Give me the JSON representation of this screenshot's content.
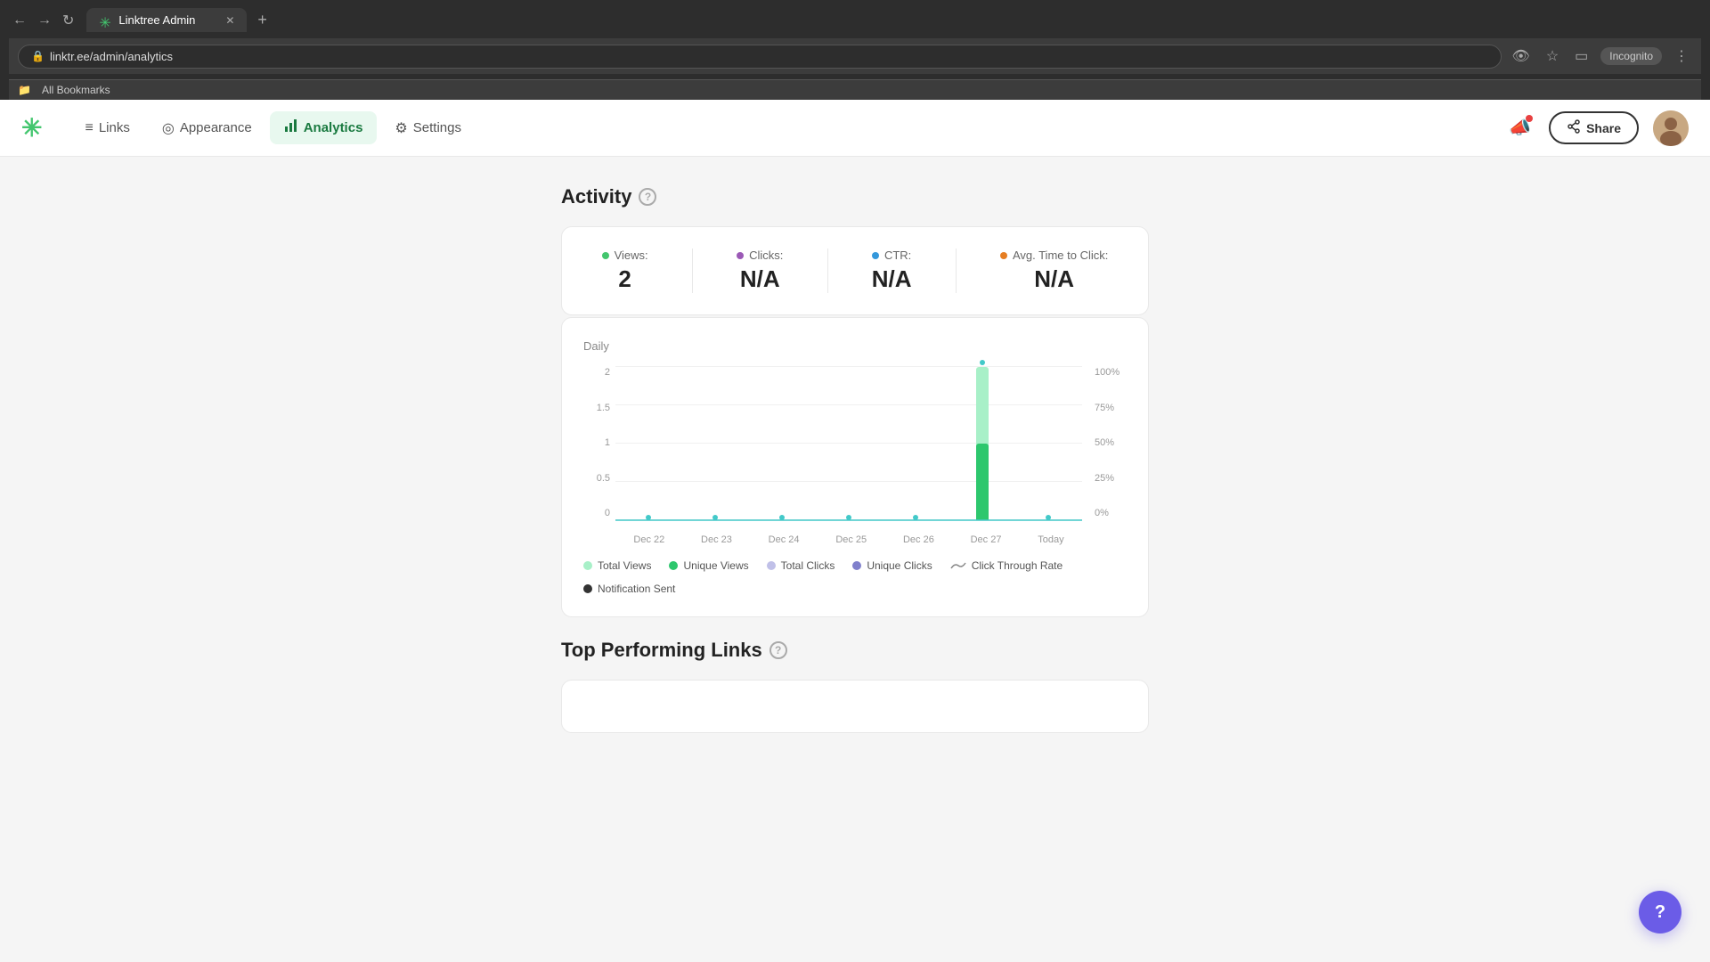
{
  "browser": {
    "tab_title": "Linktree Admin",
    "tab_favicon": "✳",
    "url": "linktr.ee/admin/analytics",
    "incognito_label": "Incognito",
    "bookmarks_label": "All Bookmarks"
  },
  "nav": {
    "logo": "✳",
    "links": [
      {
        "id": "links",
        "label": "Links",
        "icon": "≡",
        "active": false
      },
      {
        "id": "appearance",
        "label": "Appearance",
        "icon": "◎",
        "active": false
      },
      {
        "id": "analytics",
        "label": "Analytics",
        "icon": "📊",
        "active": true
      },
      {
        "id": "settings",
        "label": "Settings",
        "icon": "⚙",
        "active": false
      }
    ],
    "share_label": "Share",
    "notification_icon": "📣"
  },
  "activity": {
    "title": "Activity",
    "stats": [
      {
        "label": "Views:",
        "value": "2",
        "dot_color": "#43c66e"
      },
      {
        "label": "Clicks:",
        "value": "N/A",
        "dot_color": "#9b59b6"
      },
      {
        "label": "CTR:",
        "value": "N/A",
        "dot_color": "#3498db"
      },
      {
        "label": "Avg. Time to Click:",
        "value": "N/A",
        "dot_color": "#e67e22"
      }
    ]
  },
  "chart": {
    "period_label": "Daily",
    "y_axis_left": [
      "2",
      "1.5",
      "1",
      "0.5",
      "0"
    ],
    "y_axis_right": [
      "100%",
      "75%",
      "50%",
      "25%",
      "0%"
    ],
    "x_labels": [
      "Dec 22",
      "Dec 23",
      "Dec 24",
      "Dec 25",
      "Dec 26",
      "Dec 27",
      "Today"
    ],
    "bars": [
      {
        "date": "Dec 22",
        "total_views": 0,
        "unique_views": 0
      },
      {
        "date": "Dec 23",
        "total_views": 0,
        "unique_views": 0
      },
      {
        "date": "Dec 24",
        "total_views": 0,
        "unique_views": 0
      },
      {
        "date": "Dec 25",
        "total_views": 0,
        "unique_views": 0
      },
      {
        "date": "Dec 26",
        "total_views": 0,
        "unique_views": 0
      },
      {
        "date": "Dec 27",
        "total_views": 2,
        "unique_views": 1
      },
      {
        "date": "Today",
        "total_views": 0,
        "unique_views": 0
      }
    ],
    "legend": [
      {
        "label": "Total Views",
        "color": "#a8f0c8",
        "type": "dot"
      },
      {
        "label": "Unique Views",
        "color": "#2dc76d",
        "type": "dot"
      },
      {
        "label": "Total Clicks",
        "color": "#c0c0e8",
        "type": "dot"
      },
      {
        "label": "Unique Clicks",
        "color": "#8080cc",
        "type": "dot"
      },
      {
        "label": "Click Through Rate",
        "color": "#888",
        "type": "line"
      },
      {
        "label": "Notification Sent",
        "color": "#333",
        "type": "dot"
      }
    ]
  },
  "top_links": {
    "title": "Top Performing Links"
  },
  "help_btn": "?"
}
